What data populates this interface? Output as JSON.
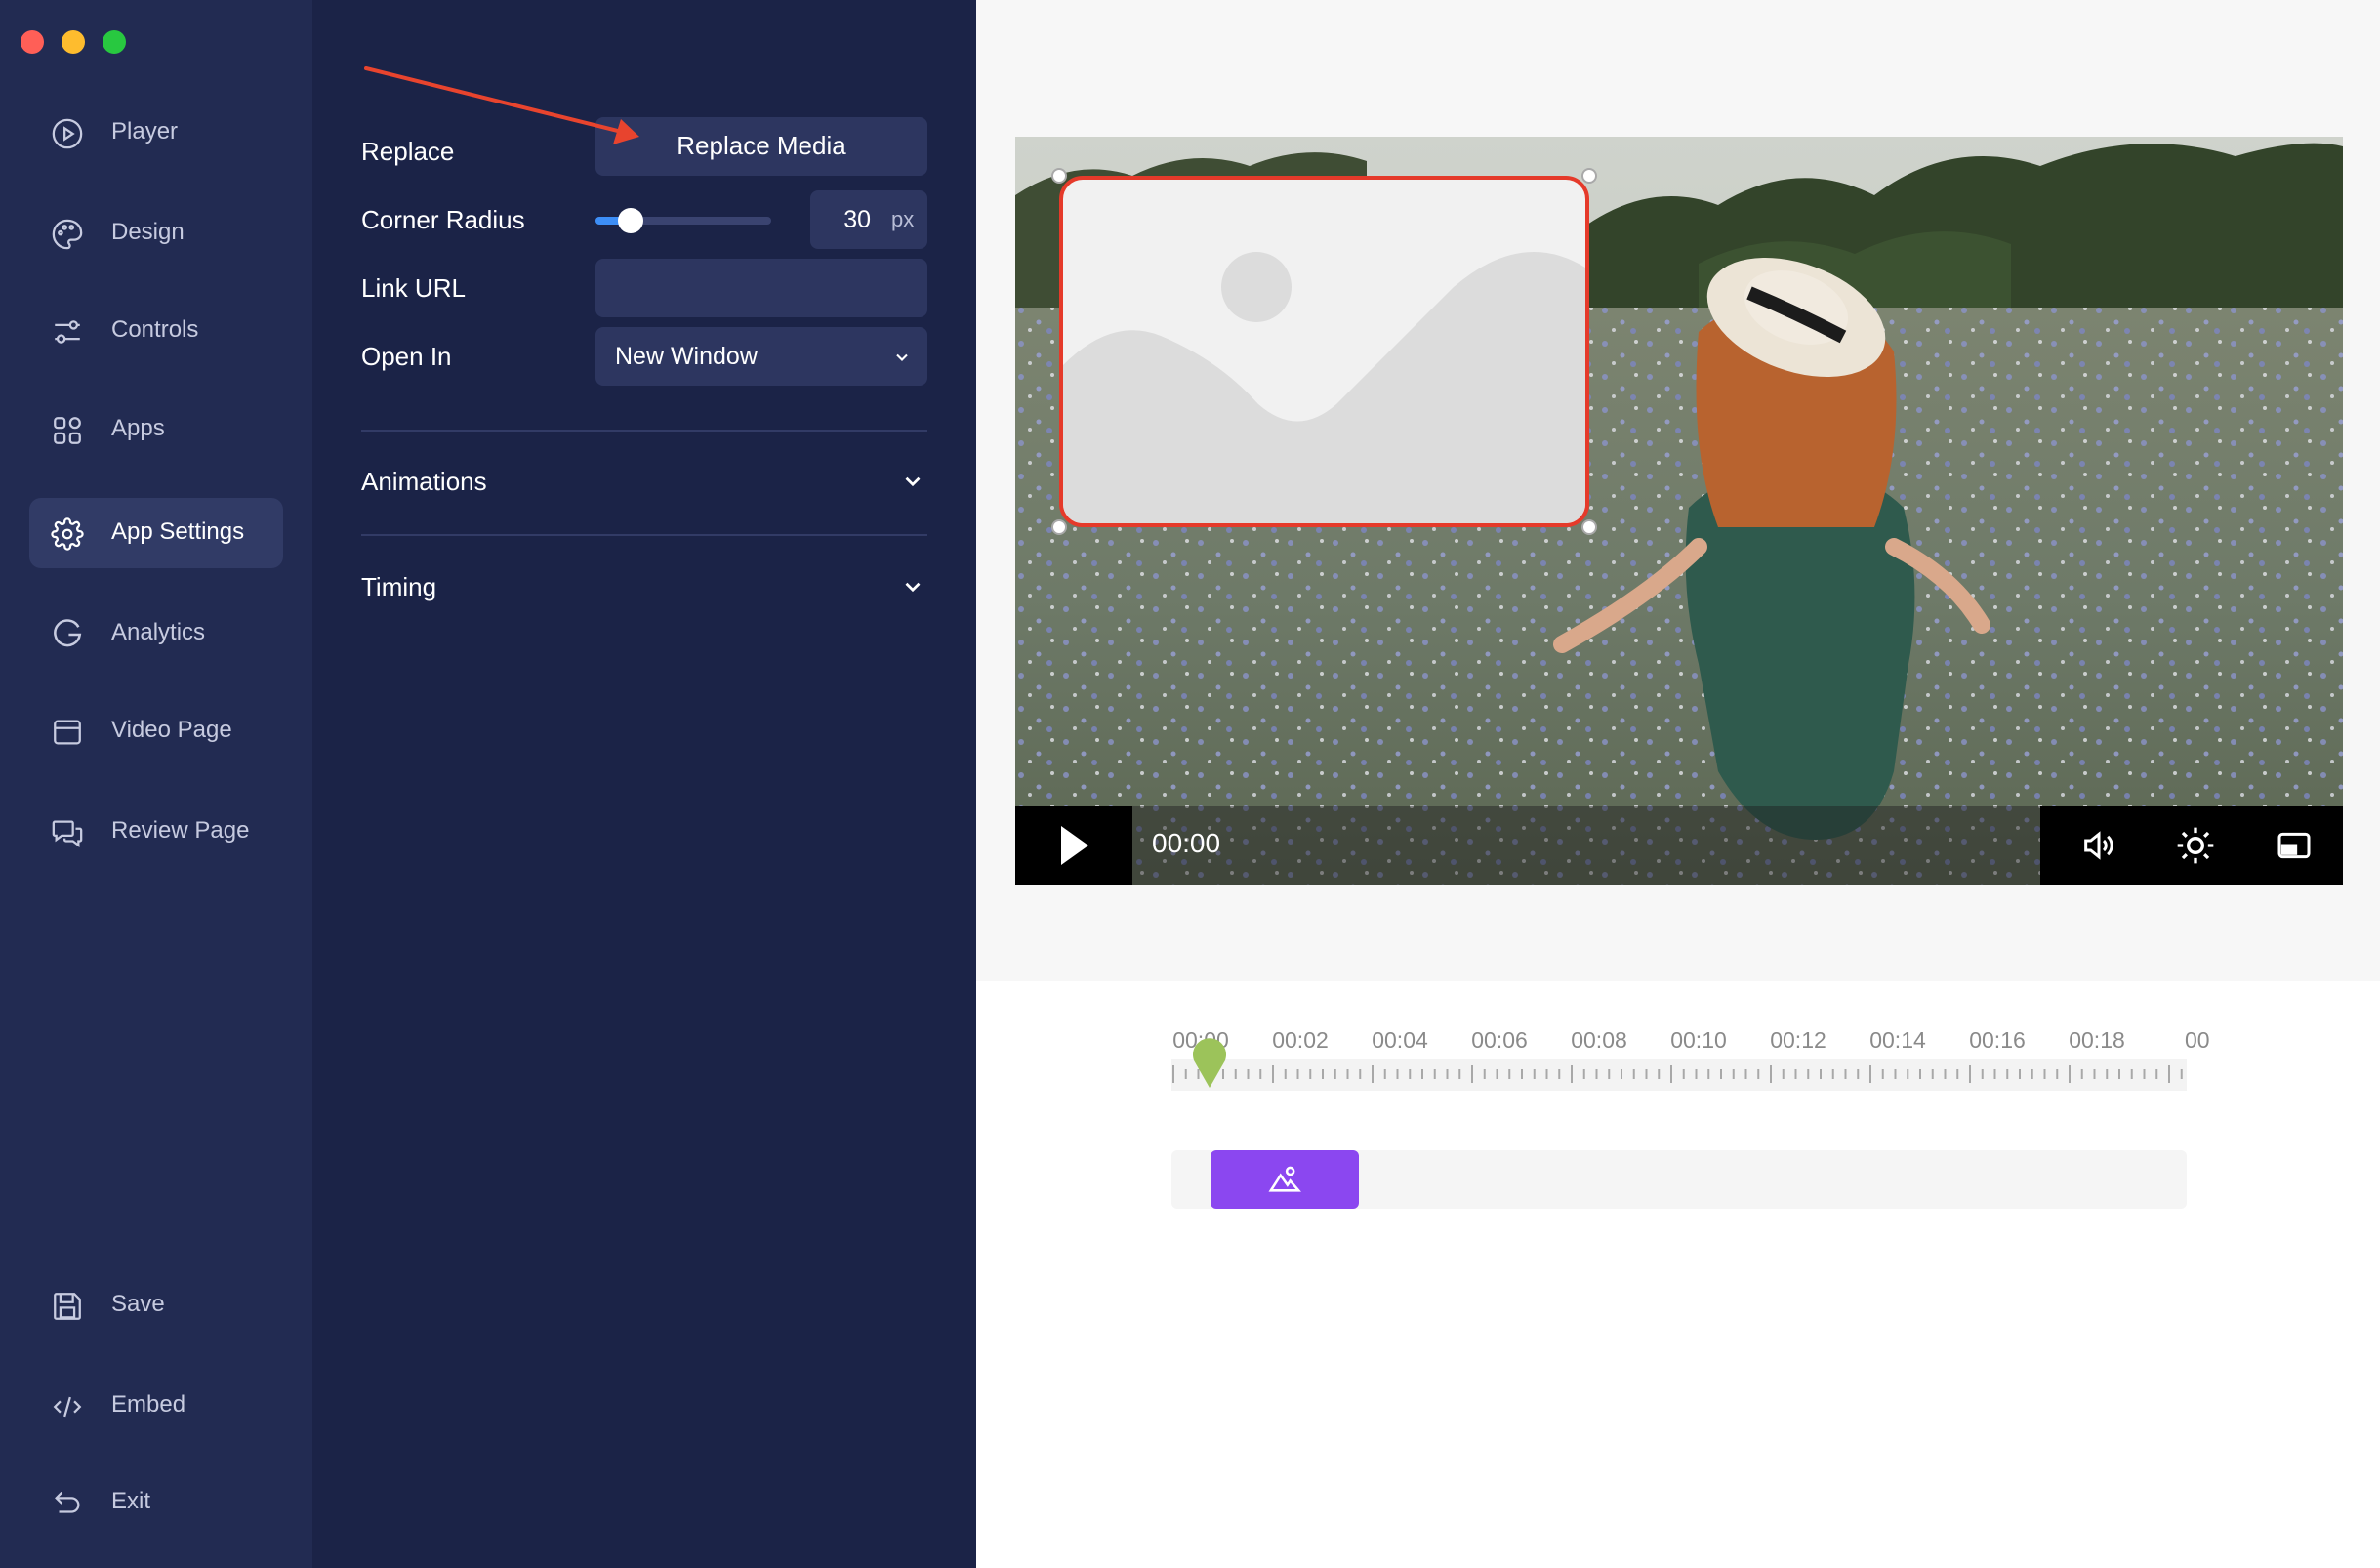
{
  "window": {
    "traffic_lights": {
      "close": "#ff5f57",
      "minimize": "#febc2e",
      "zoom": "#28c840"
    }
  },
  "sidebar": {
    "items": [
      {
        "label": "Player",
        "icon": "play-circle-icon"
      },
      {
        "label": "Design",
        "icon": "palette-icon"
      },
      {
        "label": "Controls",
        "icon": "sliders-icon"
      },
      {
        "label": "Apps",
        "icon": "apps-grid-icon"
      },
      {
        "label": "App Settings",
        "icon": "gear-icon",
        "active": true
      },
      {
        "label": "Analytics",
        "icon": "analytics-icon"
      },
      {
        "label": "Video Page",
        "icon": "browser-window-icon"
      },
      {
        "label": "Review Page",
        "icon": "chat-bubbles-icon"
      }
    ],
    "bottom_items": [
      {
        "label": "Save",
        "icon": "floppy-disk-icon"
      },
      {
        "label": "Embed",
        "icon": "code-icon"
      },
      {
        "label": "Exit",
        "icon": "exit-arrow-icon"
      }
    ]
  },
  "settings": {
    "replace_label": "Replace",
    "replace_button": "Replace Media",
    "corner_radius_label": "Corner Radius",
    "corner_radius_value": "30",
    "corner_radius_unit": "px",
    "corner_radius_slider_fraction": 0.2,
    "link_url_label": "Link URL",
    "link_url_value": "",
    "open_in_label": "Open In",
    "open_in_value": "New Window",
    "animations_label": "Animations",
    "timing_label": "Timing"
  },
  "player": {
    "current_time": "00:00"
  },
  "timeline": {
    "ticks": [
      "00:00",
      "00:02",
      "00:04",
      "00:06",
      "00:08",
      "00:10",
      "00:12",
      "00:14",
      "00:16",
      "00:18",
      "00"
    ]
  },
  "colors": {
    "accent": "#3d8ef7",
    "clip": "#8b47f0",
    "playhead": "#9cc35a",
    "selection": "#e53a2a",
    "annotation_arrow": "#e8442e"
  }
}
